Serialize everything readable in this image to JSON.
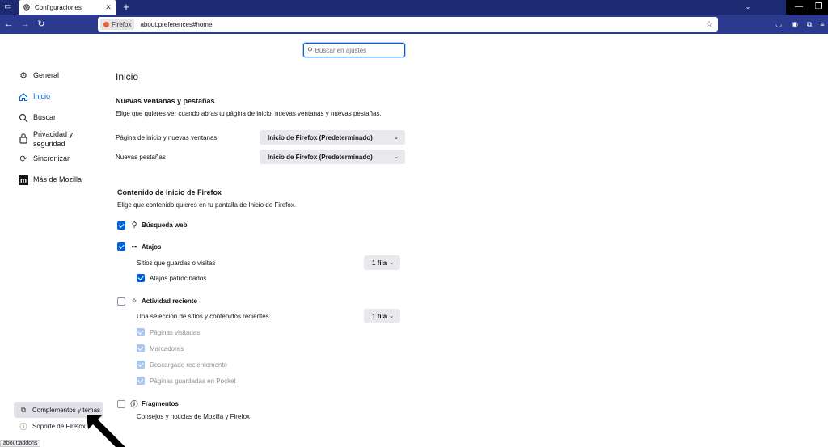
{
  "window": {
    "tab_title": "Configuraciones",
    "tab_close": "✕",
    "new_tab": "+",
    "overflow": "⌄",
    "minimize": "—",
    "maximize": "❐"
  },
  "navbar": {
    "identity_label": "Firefox",
    "url": "about:preferences#home"
  },
  "search": {
    "placeholder": "Buscar en ajustes"
  },
  "sidebar": {
    "items": [
      {
        "label": "General"
      },
      {
        "label": "Inicio"
      },
      {
        "label": "Buscar"
      },
      {
        "label": "Privacidad y seguridad"
      },
      {
        "label": "Sincronizar"
      },
      {
        "label": "Más de Mozilla"
      }
    ],
    "addons_label": "Complementos y temas",
    "support_label": "Soporte de Firefox"
  },
  "status_text": "about:addons",
  "main": {
    "title": "Inicio",
    "windows_section": {
      "heading": "Nuevas ventanas y pestañas",
      "description": "Elige que quieres ver cuando abras tu página de inicio, nuevas ventanas y nuevas pestañas.",
      "homepage_label": "Página de inicio y nuevas ventanas",
      "homepage_value": "Inicio de Firefox (Predeterminado)",
      "newtabs_label": "Nuevas pestañas",
      "newtabs_value": "Inicio de Firefox (Predeterminado)"
    },
    "content_section": {
      "heading": "Contenido de Inicio de Firefox",
      "description": "Elige que contenido quieres en tu pantalla de Inicio de Firefox.",
      "web_search": {
        "label": "Búsqueda web",
        "checked": true
      },
      "shortcuts": {
        "label": "Atajos",
        "checked": true,
        "rows_label": "Sitios que guardas o visitas",
        "rows_value": "1 fila",
        "sponsored_label": "Atajos patrocinados",
        "sponsored_checked": true
      },
      "recent": {
        "label": "Actividad reciente",
        "checked": false,
        "rows_label": "Una selección de sitios y contenidos recientes",
        "rows_value": "1 fila",
        "options": [
          {
            "label": "Páginas visitadas"
          },
          {
            "label": "Marcadores"
          },
          {
            "label": "Descargado recientemente"
          },
          {
            "label": "Páginas guardadas en Pocket"
          }
        ]
      },
      "snippets": {
        "label": "Fragmentos",
        "checked": false,
        "description": "Consejos y noticias de Mozilla y Firefox"
      }
    }
  }
}
